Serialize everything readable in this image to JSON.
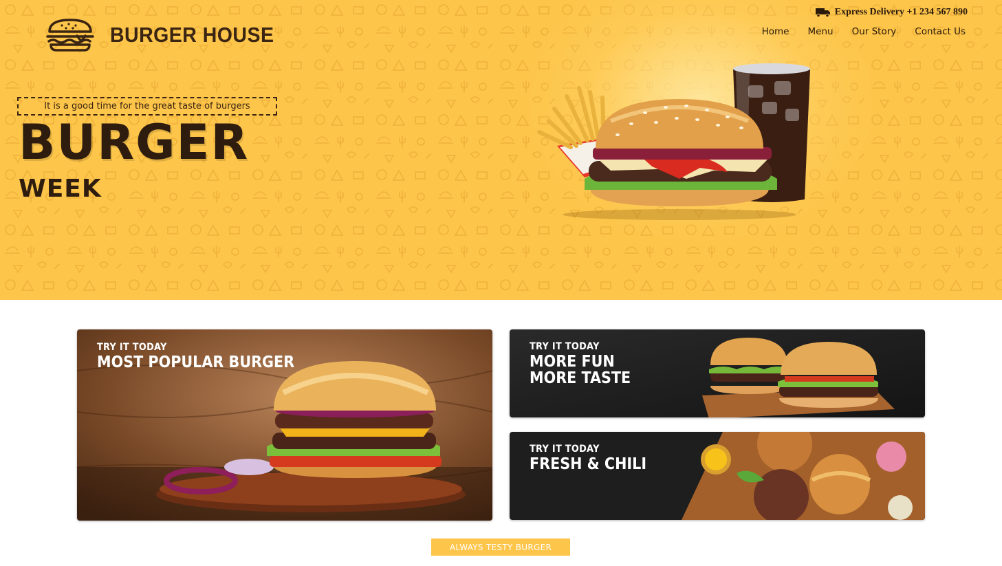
{
  "brand": {
    "name": "BURGER HOUSE",
    "logo_icon": "burger-icon",
    "primary_color": "#fdc54a",
    "text_color": "#2e1d0f"
  },
  "header": {
    "delivery_icon": "truck-icon",
    "delivery_text": "Express Delivery +1 234 567 890",
    "nav": [
      {
        "label": "Home"
      },
      {
        "label": "Menu"
      },
      {
        "label": "Our Story"
      },
      {
        "label": "Contact Us"
      }
    ]
  },
  "hero": {
    "tagline": "It is a good time for the great taste of burgers",
    "title": "BURGER",
    "subtitle": "WEEK"
  },
  "promos": [
    {
      "kicker": "TRY IT TODAY",
      "headline": "MOST POPULAR BURGER"
    },
    {
      "kicker": "TRY IT TODAY",
      "headline": "MORE FUN\nMORE TASTE"
    },
    {
      "kicker": "TRY IT TODAY",
      "headline": "FRESH & CHILI"
    }
  ],
  "cta": {
    "label": "ALWAYS TESTY BURGER"
  }
}
